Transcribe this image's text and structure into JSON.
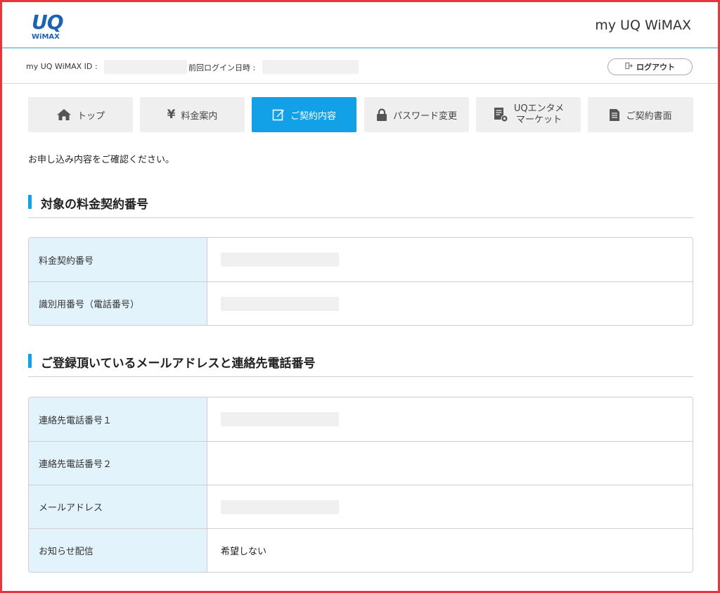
{
  "header": {
    "logo_top": "UQ",
    "logo_bottom": "WiMAX",
    "title": "my UQ WiMAX"
  },
  "infobar": {
    "id_label": "my UQ WiMAX ID :",
    "last_login_label": "前回ログイン日時 :",
    "logout_label": "ログアウト",
    "logout_icon": "logout-icon"
  },
  "nav": {
    "items": [
      {
        "label": "トップ",
        "icon": "home-icon",
        "active": false
      },
      {
        "label": "料金案内",
        "icon": "yen-icon",
        "active": false
      },
      {
        "label": "ご契約内容",
        "icon": "edit-icon",
        "active": true
      },
      {
        "label": "パスワード変更",
        "icon": "lock-icon",
        "active": false
      },
      {
        "label_line1": "UQエンタメ",
        "label_line2": "マーケット",
        "icon": "document-gear-icon",
        "active": false
      },
      {
        "label": "ご契約書面",
        "icon": "document-icon",
        "active": false
      }
    ],
    "active_color": "#12a0e6"
  },
  "main": {
    "intro": "お申し込み内容をご確認ください。",
    "section1": {
      "title": "対象の料金契約番号",
      "rows": [
        {
          "label": "料金契約番号",
          "value": ""
        },
        {
          "label": "識別用番号（電話番号）",
          "value": ""
        }
      ]
    },
    "section2": {
      "title": "ご登録頂いているメールアドレスと連絡先電話番号",
      "rows": [
        {
          "label": "連絡先電話番号１",
          "value": ""
        },
        {
          "label": "連絡先電話番号２",
          "value": ""
        },
        {
          "label": "メールアドレス",
          "value": ""
        },
        {
          "label": "お知らせ配信",
          "value": "希望しない"
        }
      ]
    }
  }
}
